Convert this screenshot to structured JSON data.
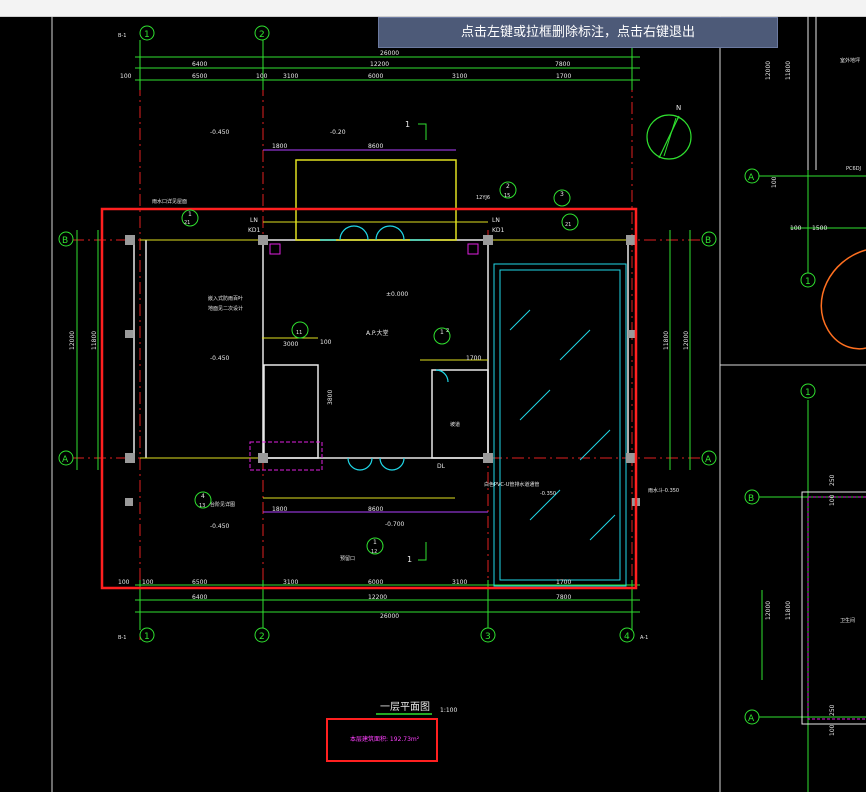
{
  "tooltip": {
    "text": "点击左键或拉框删除标注，点击右键退出"
  },
  "drawing": {
    "title": "一层平面图",
    "scale": "1:100",
    "area_text": "本层建筑面积: 192.73m²",
    "north_label": "N",
    "dims_top_total": "26000",
    "dims_top_row1": [
      "6400",
      "12200",
      "7800"
    ],
    "dims_top_row2": [
      "100",
      "6500",
      "100",
      "3100",
      "6000",
      "3100",
      "1700"
    ],
    "dims_bottom_row1": [
      "100",
      "100",
      "6500",
      "3100",
      "6000",
      "3100",
      "1700"
    ],
    "dims_bottom_row2": [
      "6400",
      "12200",
      "7800"
    ],
    "dims_bottom_total": "26000",
    "dims_side": [
      "12000",
      "11800"
    ],
    "inner_dims": [
      "1800",
      "8600",
      "3000",
      "100",
      "1700",
      "3800",
      "1800",
      "8600"
    ],
    "axes_top": [
      "1",
      "2"
    ],
    "axes_bottom": [
      "1",
      "2",
      "3",
      "4"
    ],
    "axes_side": [
      "B",
      "A"
    ],
    "axis_refs": [
      "B-1",
      "B-1",
      "A-1"
    ],
    "levels": [
      "-0.450",
      "-0.20",
      "±0.000",
      "-0.450",
      "-0.450",
      "-0.700",
      "-0.350"
    ],
    "room_label": "A.P.大堂",
    "detail_refs": [
      "1",
      "12YJ6",
      "2",
      "15",
      "12YJ6",
      "3",
      "1",
      "21",
      "11",
      "4",
      "13",
      "1",
      "12",
      "2"
    ],
    "section_marks": [
      "1",
      "1"
    ],
    "notes": [
      "雨水口详见屋面",
      "嵌入式防雨百叶",
      "地面见二次设计",
      "白色PVC-U管排水道通管",
      "雨水斗-0.350",
      "台阶见详图",
      "坡道",
      "预留口"
    ],
    "door_tags": [
      "LN",
      "KD1",
      "LN",
      "KD1",
      "DL"
    ],
    "right_panel": {
      "axes": [
        "A",
        "1",
        "B",
        "A"
      ],
      "dims": [
        "100",
        "1500",
        "100",
        "12000",
        "11800",
        "100",
        "250",
        "100",
        "250"
      ],
      "labels": [
        "PC6DJ",
        "室外地坪",
        "卫生间"
      ]
    }
  }
}
